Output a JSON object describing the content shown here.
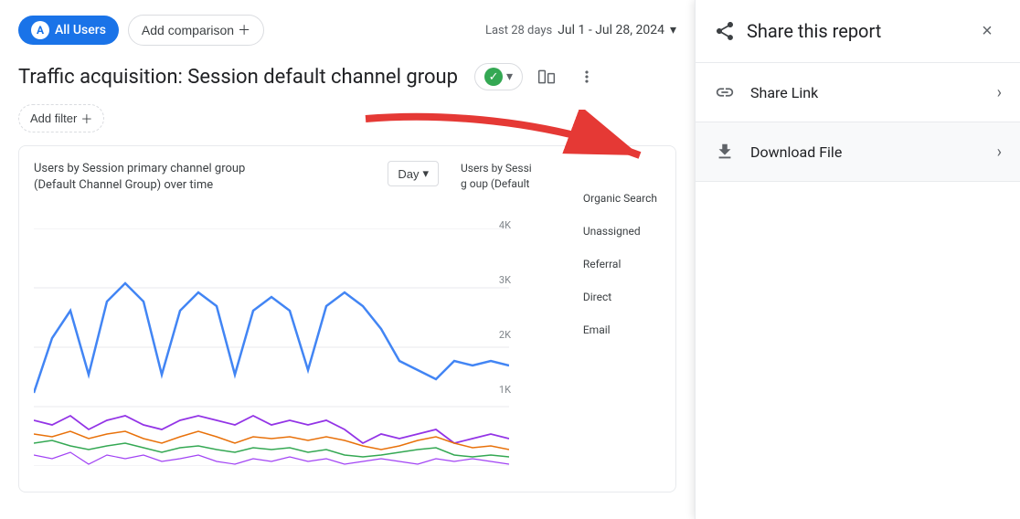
{
  "header": {
    "all_users_label": "All Users",
    "all_users_avatar": "A",
    "add_comparison_label": "Add comparison",
    "date_last": "Last 28 days",
    "date_range": "Jul 1 - Jul 28, 2024",
    "chevron_down": "▾"
  },
  "report": {
    "title": "Traffic acquisition: Session default channel group",
    "add_filter_label": "Add filter",
    "plus": "+"
  },
  "chart": {
    "title_line1": "Users by Session primary channel group",
    "title_line2": "(Default Channel Group) over time",
    "day_label": "Day",
    "column_title": "Users by Sessi",
    "column_title2": "g oup (Default",
    "y_labels": [
      "4K",
      "3K",
      "2K",
      "1K",
      ""
    ],
    "legend": [
      {
        "label": "Organic Search",
        "color": "#1a73e8"
      },
      {
        "label": "Unassigned",
        "color": "#9334e6"
      },
      {
        "label": "Referral",
        "color": "#e8710a"
      },
      {
        "label": "Direct",
        "color": "#34a853"
      },
      {
        "label": "Email",
        "color": "#a142f4"
      }
    ]
  },
  "share_panel": {
    "title": "Share this report",
    "share_link_label": "Share Link",
    "download_file_label": "Download File",
    "close_label": "×"
  }
}
